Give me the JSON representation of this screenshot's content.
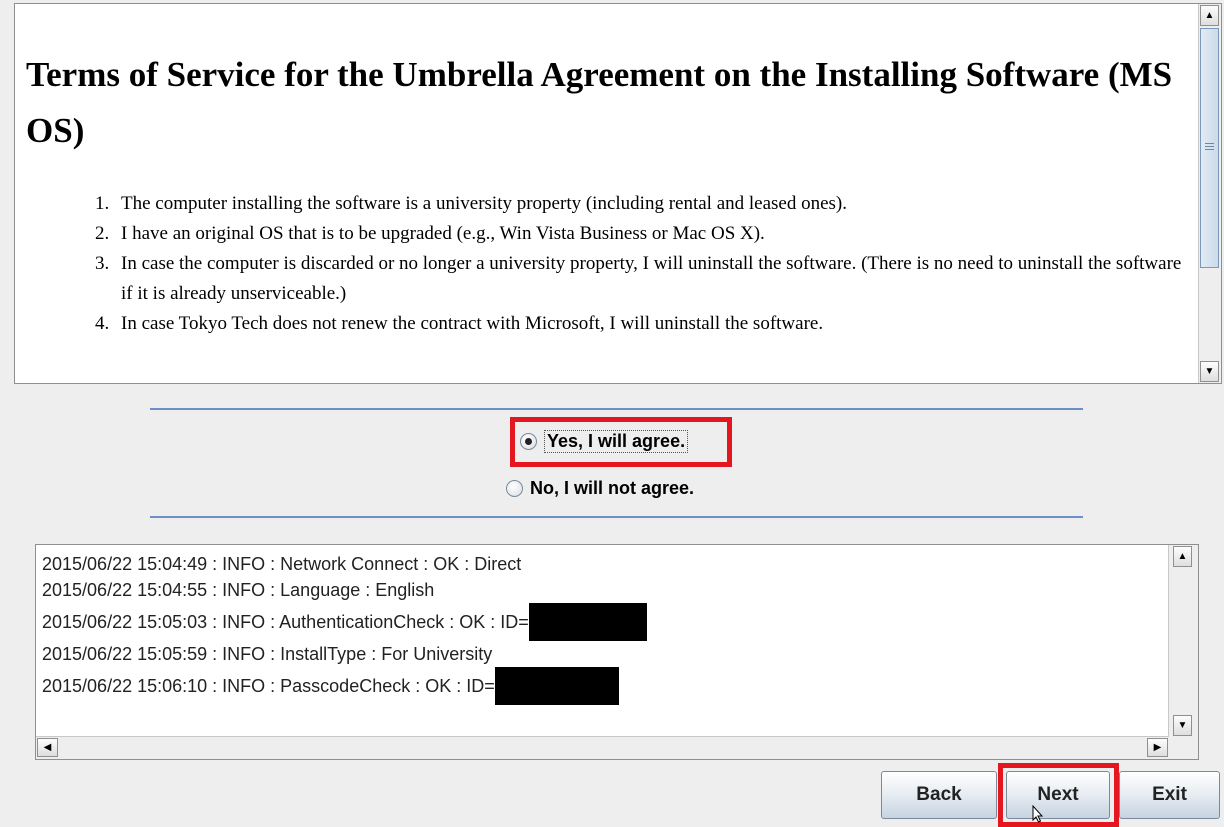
{
  "terms": {
    "title": "Terms of Service for the Umbrella Agreement on the Installing Software (MS OS)",
    "items": [
      "The computer installing the software is a university property (including rental and leased ones).",
      "I have an original OS that is to be upgraded (e.g., Win Vista Business or Mac OS X).",
      "In case the computer is discarded or no longer a university property, I will uninstall the software. (There is no need to uninstall the software if it is already unserviceable.)",
      "In case Tokyo Tech does not renew the contract with Microsoft, I will uninstall the software."
    ]
  },
  "agreement": {
    "yes_label": "Yes, I will agree.",
    "no_label": "No, I will not agree.",
    "selected": "yes"
  },
  "log": {
    "lines": [
      {
        "text": "2015/06/22 15:04:49 : INFO  : Network Connect : OK : Direct",
        "redacted": false
      },
      {
        "text": "2015/06/22 15:04:55 : INFO  : Language : English",
        "redacted": false
      },
      {
        "text": "2015/06/22 15:05:03 : INFO  : AuthenticationCheck : OK : ID=",
        "redacted": true
      },
      {
        "text": "2015/06/22 15:05:59 : INFO  : InstallType : For University",
        "redacted": false
      },
      {
        "text": "2015/06/22 15:06:10 : INFO  : PasscodeCheck : OK : ID=",
        "redacted": true
      }
    ]
  },
  "buttons": {
    "back": "Back",
    "next": "Next",
    "exit": "Exit"
  },
  "colors": {
    "highlight": "#e4161f",
    "separator": "#6d8fc7"
  },
  "icons": {
    "scroll_up": "triangle-up-icon",
    "scroll_down": "triangle-down-icon",
    "scroll_left": "triangle-left-icon",
    "scroll_right": "triangle-right-icon",
    "cursor": "mouse-pointer-icon"
  }
}
